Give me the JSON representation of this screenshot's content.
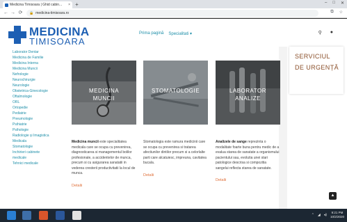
{
  "browser": {
    "tab_title": "Medicina Timisoara | Ghid cabin...",
    "tab_close": "×",
    "new_tab": "+",
    "url": "medicina-timisoara.ro",
    "back": "←",
    "forward": "→",
    "reload": "⟳",
    "minimize": "–",
    "maximize": "□",
    "close": "✕"
  },
  "logo": {
    "line1": "MEDICINA",
    "line2": "TIMISOARA"
  },
  "nav": {
    "home": "Prima pagină",
    "specialties": "Specialitati ▾"
  },
  "sidebar": {
    "items": [
      "Laborator Dentar",
      "Medicina de Familie",
      "Medicina Interna",
      "Medicina Muncii",
      "Nefrologie",
      "Neurochirurgie",
      "Neurologie",
      "Obstetrica-Ginecologie",
      "Oftalmologie",
      "ORL",
      "Ortopedie",
      "Pediatrie",
      "Pneumologie",
      "Psihiatrie",
      "Psihologie",
      "Radiologie și Imagistica",
      "Medicala",
      "Stomatologie",
      "Inchirieri cabinete",
      "medicale",
      "Tehnici medicale"
    ]
  },
  "cards": [
    {
      "label_1": "MEDICINA",
      "label_2": "MUNCII",
      "bold": "Medicina muncii",
      "text": " este specialitatea medicala care se ocupa cu prevenirea, diagnosticarea si managementul bolilor profesionale, a accidentelor de munca, precum si cu asigurarea sanatatii in vederea cresterii productivitatii la locul de munca.",
      "more": "Detalii"
    },
    {
      "label_1": "STOMATOLOGIE",
      "label_2": "",
      "bold": "",
      "text": "Stomatologia este ramura medicinii care se ocupa cu prevenirea si tratarea afectiunilor dintilor precum si a celorlalte parti care alcatuiesc, impreuna, cavitatea bucala.",
      "more": "Detalii"
    },
    {
      "label_1": "LABORATOR",
      "label_2": "ANALIZE",
      "bold": "Analizele de sange",
      "text": " reprezinta o modalitate foarte buna pentru medic de a evalua starea de sanatate a organismului pacientului sau, evolutia unei stari patologice descrisa si compozitia sangelui reflecta starea de sanatate.",
      "more": "Detalii"
    }
  ],
  "urgent": {
    "line1": "SERVICIUL",
    "line2": "DE URGENȚĂ"
  },
  "taskbar": {
    "time": "9:21 PM",
    "date": "10/2/2020"
  },
  "colors": {
    "brand": "#1d5fb3",
    "link": "#1d8ea8",
    "accent": "#e0703a",
    "urgent_text": "#8a4f2a"
  }
}
